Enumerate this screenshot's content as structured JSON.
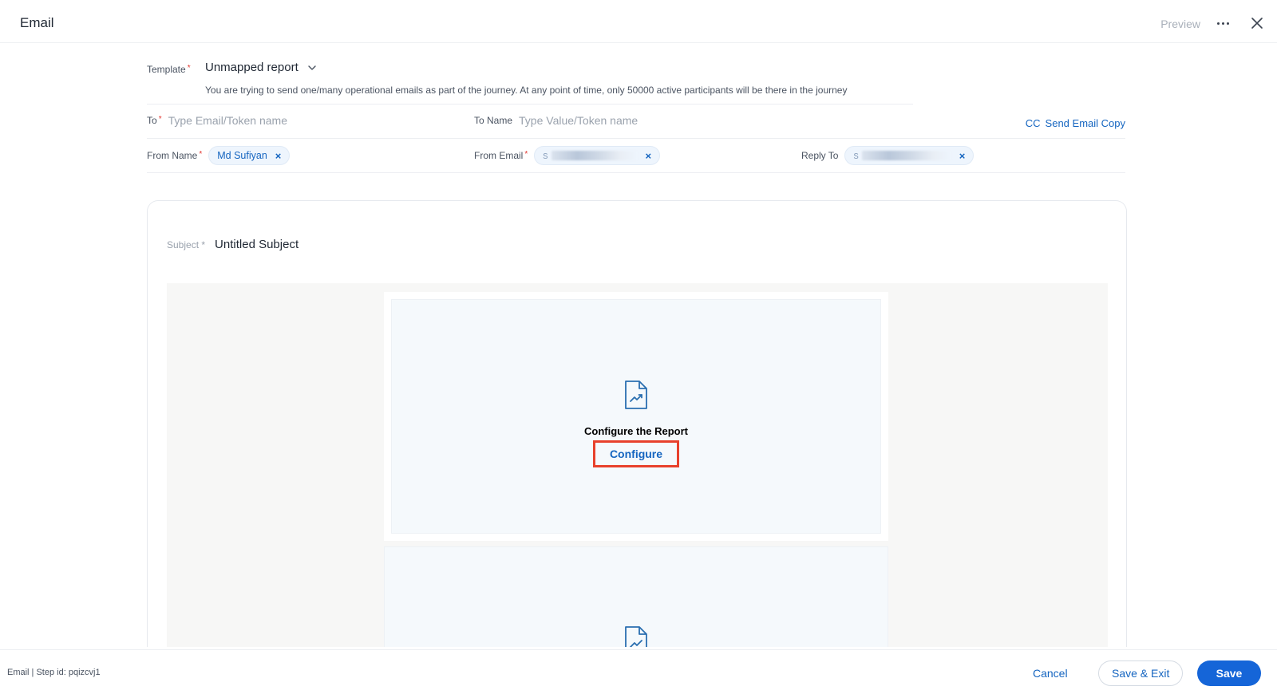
{
  "header": {
    "title": "Email",
    "preview_label": "Preview",
    "more_icon": "more-horizontal-icon",
    "close_icon": "close-icon"
  },
  "template": {
    "label": "Template",
    "required_mark": "*",
    "value": "Unmapped report",
    "notice": "You are trying to send one/many operational emails as part of the journey. At any point of time, only 50000 active participants will be there in the journey"
  },
  "to": {
    "label": "To",
    "required_mark": "*",
    "placeholder": "Type Email/Token name"
  },
  "to_name": {
    "label": "To Name",
    "placeholder": "Type Value/Token name"
  },
  "cc": {
    "cc_label": "CC",
    "send_copy_label": "Send Email Copy"
  },
  "from_name": {
    "label": "From Name",
    "required_mark": "*",
    "chip": "Md Sufiyan",
    "remove": "×"
  },
  "from_email": {
    "label": "From Email",
    "required_mark": "*",
    "chip_prefix": "s",
    "remove": "×"
  },
  "reply_to": {
    "label": "Reply To",
    "chip_prefix": "s",
    "remove": "×"
  },
  "subject": {
    "label": "Subject",
    "required_mark": "*",
    "value": "Untitled Subject"
  },
  "report_block": {
    "title": "Configure the Report",
    "button": "Configure",
    "icon": "report-document-icon"
  },
  "footer": {
    "meta": "Email | Step id: pqizcvj1",
    "cancel": "Cancel",
    "save_exit": "Save & Exit",
    "save": "Save"
  },
  "colors": {
    "accent": "#1565c0",
    "primary_button": "#1565d8",
    "highlight_border": "#e8412c",
    "required": "#e2342d"
  }
}
